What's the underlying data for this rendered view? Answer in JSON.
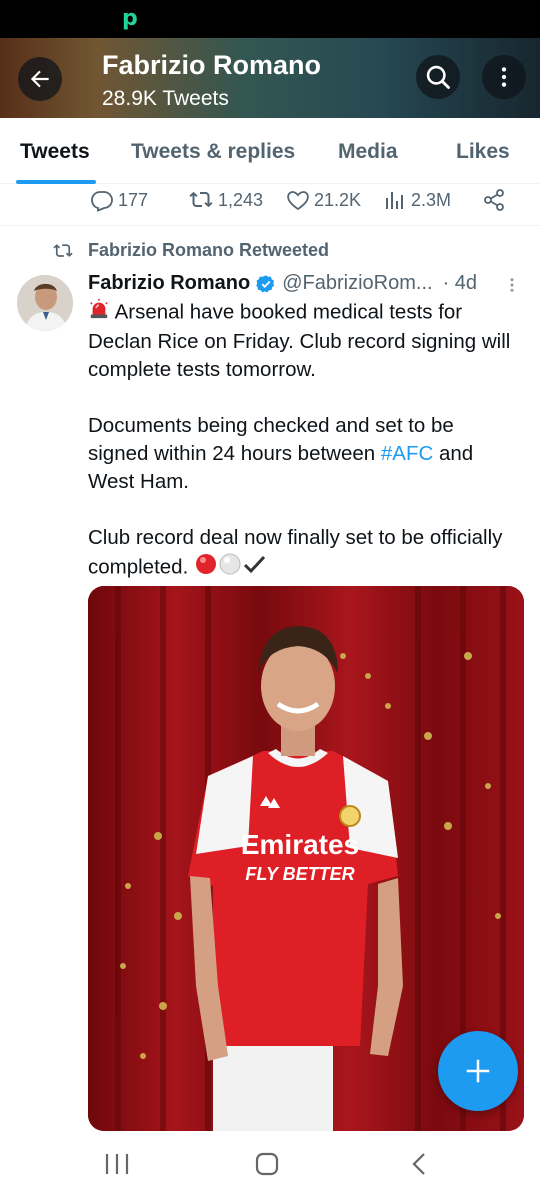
{
  "status_bar": {
    "app_glyph": "p"
  },
  "header": {
    "title": "Fabrizio Romano",
    "tweet_count": "28.9K Tweets"
  },
  "tabs": [
    {
      "label": "Tweets",
      "active": true
    },
    {
      "label": "Tweets & replies",
      "active": false
    },
    {
      "label": "Media",
      "active": false
    },
    {
      "label": "Likes",
      "active": false
    }
  ],
  "previous_tweet_actions": {
    "replies": "177",
    "retweets": "1,243",
    "likes": "21.2K",
    "views": "2.3M"
  },
  "tweet": {
    "retweet_label": "Fabrizio Romano Retweeted",
    "author": "Fabrizio Romano",
    "handle": "@FabrizioRom...",
    "time": "· 4d",
    "body": {
      "p1": "Arsenal have booked medical tests for Declan Rice on Friday. Club record signing will complete tests tomorrow.",
      "p2_before": "Documents being checked and set to be signed within 24 hours between ",
      "p2_hashtag": "#AFC",
      "p2_after": " and West Ham.",
      "p3": "Club record deal now finally set to be officially completed."
    },
    "media": {
      "shirt_sponsor_line1": "Emirates",
      "shirt_sponsor_line2": "FLY BETTER"
    }
  },
  "colors": {
    "accent": "#1d9bf0",
    "text": "#0f1419",
    "muted": "#536471"
  },
  "icons": [
    "back-arrow-icon",
    "search-icon",
    "more-vertical-icon",
    "reply-icon",
    "retweet-icon",
    "like-icon",
    "views-icon",
    "share-icon",
    "verified-badge-icon",
    "compose-plus-icon"
  ]
}
